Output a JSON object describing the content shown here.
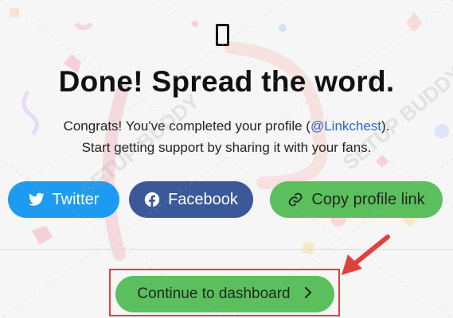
{
  "colors": {
    "twitter": "#1d9bf0",
    "facebook": "#3b5998",
    "accent_green": "#5cbf5e",
    "handle_link": "#2b63c9",
    "highlight_red": "#e0413a"
  },
  "header": {
    "emoji_icon": "missing-glyph-icon",
    "title": "Done! Spread the word."
  },
  "message": {
    "line1_prefix": "Congrats! You've completed your profile (",
    "handle": "@Linkchest",
    "line1_suffix": ").",
    "line2": "Start getting support by sharing it with your fans."
  },
  "share": {
    "twitter_label": "Twitter",
    "twitter_icon": "twitter-icon",
    "facebook_label": "Facebook",
    "facebook_icon": "facebook-icon",
    "copy_label": "Copy profile link",
    "copy_icon": "link-icon"
  },
  "footer": {
    "continue_label": "Continue to dashboard",
    "continue_icon": "chevron-right-icon"
  },
  "watermark": {
    "text": "SETUP BUDDY"
  }
}
